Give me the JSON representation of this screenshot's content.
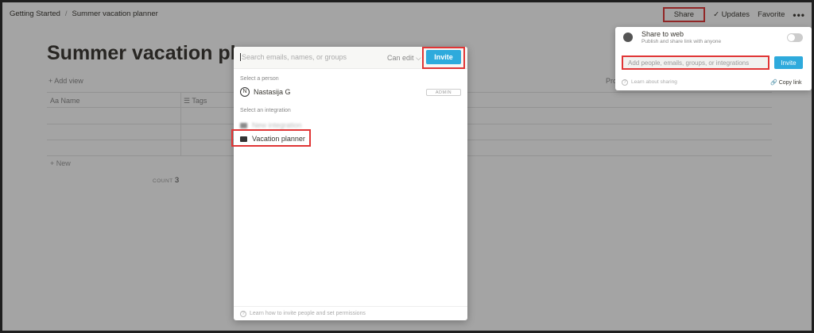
{
  "breadcrumb": {
    "items": [
      "Getting Started",
      "Summer vacation planner"
    ],
    "separator": "/"
  },
  "topbar": {
    "share": "Share",
    "updates": "Updates",
    "favorite": "Favorite",
    "more": "•••"
  },
  "page": {
    "title": "Summer vacation pla",
    "add_view": "+ Add view",
    "property_label": "Pro",
    "columns": [
      {
        "icon": "text-icon",
        "label": "Name"
      },
      {
        "icon": "list-icon",
        "label": "Tags"
      }
    ],
    "new_row": "+ New",
    "count_label": "COUNT",
    "count_value": "3"
  },
  "invite_modal": {
    "search_placeholder": "Search emails, names, or groups",
    "permission": "Can edit",
    "permission_chevron": "⌵",
    "invite_label": "Invite",
    "select_person_label": "Select a person",
    "person": {
      "initial": "N",
      "name": "Nastasija G",
      "badge": "ADMIN"
    },
    "select_integration_label": "Select an integration",
    "integrations": [
      {
        "name": "New integration",
        "blurred": true
      },
      {
        "name": "Vacation planner",
        "blurred": false
      }
    ],
    "footer": "Learn how to invite people and set permissions"
  },
  "share_popover": {
    "share_web_title": "Share to web",
    "share_web_subtitle": "Publish and share link with anyone",
    "share_web_enabled": false,
    "add_people_placeholder": "Add people, emails, groups, or integrations",
    "invite_label": "Invite",
    "learn_sharing": "Learn about sharing",
    "copy_link": "Copy link"
  },
  "colors": {
    "accent": "#2eaadc",
    "highlight": "#e03535",
    "text": "#37352f"
  }
}
